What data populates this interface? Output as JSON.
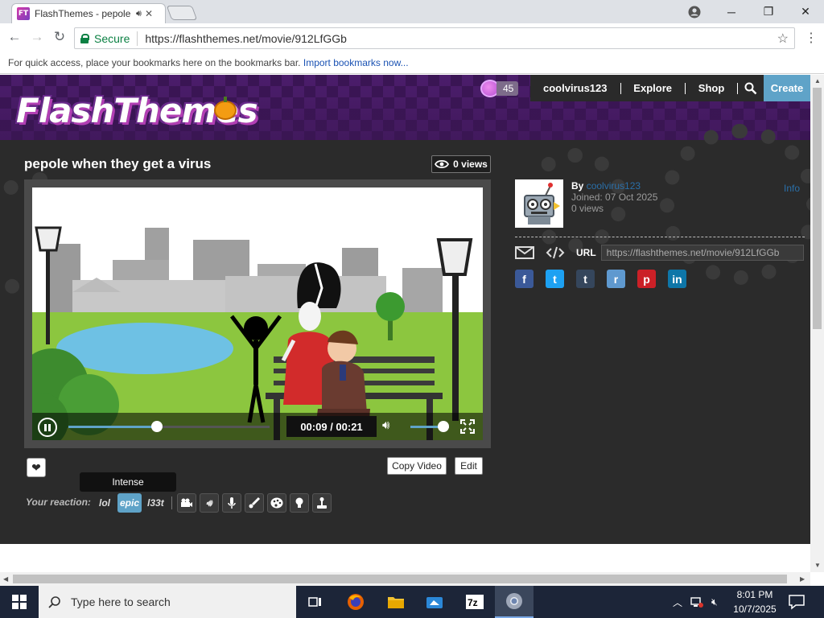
{
  "browser": {
    "tab_title": "FlashThemes - pepole when they get a virus",
    "favicon_text": "FT",
    "omnibox": {
      "secure_label": "Secure",
      "url": "https://flashthemes.net/movie/912LfGGb"
    },
    "bookmarks_bar": {
      "message": "For quick access, place your bookmarks here on the bookmarks bar.",
      "link": "Import bookmarks now..."
    }
  },
  "site": {
    "logo_text": "FlashThemes",
    "coins": "45",
    "nav": {
      "username": "coolvirus123",
      "explore": "Explore",
      "shop": "Shop",
      "create": "Create"
    }
  },
  "video": {
    "title": "pepole when they get a virus",
    "views_badge": "0 views",
    "time": "00:09 / 00:21",
    "progress_fraction": 0.44,
    "volume_fraction": 0.85
  },
  "uploader": {
    "by_label": "By",
    "name": "coolvirus123",
    "joined": "Joined: 07 Oct 2025",
    "views": "0 views",
    "info_link": "Info"
  },
  "share": {
    "url_label": "URL",
    "url_value": "https://flashthemes.net/movie/912LfGGb",
    "social": [
      {
        "name": "facebook",
        "glyph": "f",
        "color": "#3b5998"
      },
      {
        "name": "twitter",
        "glyph": "t",
        "color": "#1da1f2"
      },
      {
        "name": "tumblr",
        "glyph": "t",
        "color": "#35465c"
      },
      {
        "name": "reddit",
        "glyph": "r",
        "color": "#5f99cf"
      },
      {
        "name": "pinterest",
        "glyph": "p",
        "color": "#cb2027"
      },
      {
        "name": "linkedin",
        "glyph": "in",
        "color": "#0e76a8"
      }
    ]
  },
  "actions": {
    "copy_video": "Copy Video",
    "edit": "Edit",
    "tooltip": "Intense",
    "reaction_label": "Your reaction:",
    "reactions_text": [
      "lol",
      "epic",
      "l33t"
    ]
  },
  "taskbar": {
    "search_placeholder": "Type here to search",
    "time": "8:01 PM",
    "date": "10/7/2025"
  },
  "colors": {
    "accent": "#5fa3c8",
    "header_purple": "#3a1554",
    "content_bg": "#2b2b2b",
    "secure_green": "#0b8043"
  }
}
